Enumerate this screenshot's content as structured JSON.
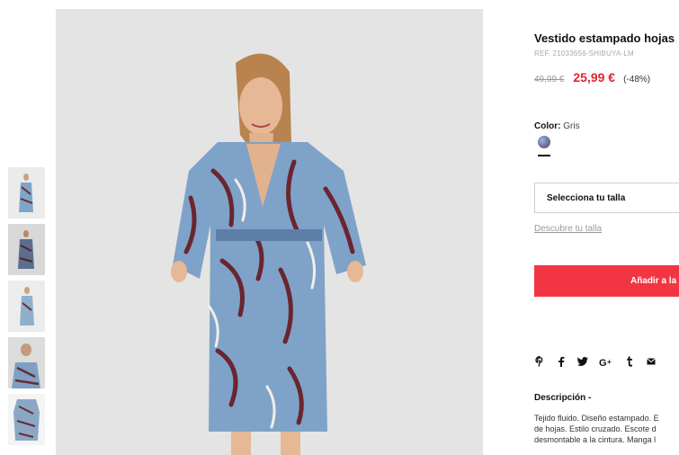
{
  "product": {
    "title": "Vestido estampado hojas",
    "ref": "REF. 21033656-SHIBUYA-LM",
    "old_price": "49,99 €",
    "new_price": "25,99 €",
    "discount": "(-48%)",
    "color_label": "Color:",
    "color_value": "Gris"
  },
  "size_select": {
    "placeholder": "Selecciona tu talla"
  },
  "size_guide_label": "Descubre tu talla",
  "add_to_cart_label": "Añadir a la",
  "social_icons": [
    "pinterest-icon",
    "facebook-icon",
    "twitter-icon",
    "google-plus-icon",
    "tumblr-icon",
    "email-icon"
  ],
  "description": {
    "title": "Descripción -",
    "lines": [
      "Tejido fluido. Diseño estampado. E",
      "de hojas. Estilo cruzado. Escote d",
      "desmontable a la cintura. Manga l"
    ]
  },
  "colors": {
    "accent": "#f23542",
    "sale_price": "#e0242f",
    "image_bg": "#e6e6e6"
  }
}
